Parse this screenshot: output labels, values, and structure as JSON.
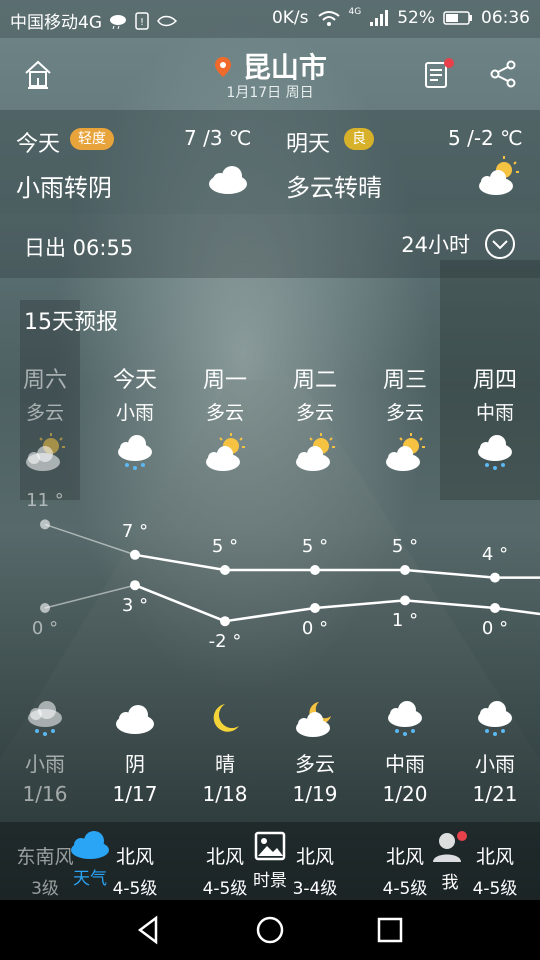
{
  "status_bar": {
    "carrier": "中国移动4G",
    "speed": "0K/s",
    "network": "4G",
    "battery": "52%",
    "time": "06:36"
  },
  "header": {
    "city": "昆山市",
    "date": "1月17日 周日"
  },
  "today": {
    "label": "今天",
    "aqi": "轻度",
    "aqi_color": "#e8a33a",
    "temp": "7 /3 ℃",
    "condition": "小雨转阴",
    "icon": "cloud-icon"
  },
  "tomorrow": {
    "label": "明天",
    "aqi": "良",
    "aqi_color": "#d8b12a",
    "temp": "5 /-2 ℃",
    "condition": "多云转晴",
    "icon": "partly-sunny-icon"
  },
  "sunrise": {
    "text": "日出 06:55",
    "toggle_label": "24小时"
  },
  "forecast": {
    "title": "15天预报",
    "days": [
      {
        "weekday": "周六",
        "day_condition": "多云",
        "high": "11 °",
        "low": "0 °",
        "night_condition": "小雨",
        "date": "1/16",
        "past": true
      },
      {
        "weekday": "今天",
        "day_condition": "小雨",
        "high": "7 °",
        "low": "3 °",
        "night_condition": "阴",
        "date": "1/17",
        "past": false
      },
      {
        "weekday": "周一",
        "day_condition": "多云",
        "high": "5 °",
        "low": "-2 °",
        "night_condition": "晴",
        "date": "1/18",
        "past": false
      },
      {
        "weekday": "周二",
        "day_condition": "多云",
        "high": "5 °",
        "low": "0 °",
        "night_condition": "多云",
        "date": "1/19",
        "past": false
      },
      {
        "weekday": "周三",
        "day_condition": "多云",
        "high": "5 °",
        "low": "1 °",
        "night_condition": "中雨",
        "date": "1/20",
        "past": false
      },
      {
        "weekday": "周四",
        "day_condition": "中雨",
        "high": "4 °",
        "low": "0 °",
        "night_condition": "小雨",
        "date": "1/21",
        "past": false
      }
    ],
    "high_values": [
      11,
      7,
      5,
      5,
      5,
      4
    ],
    "low_values": [
      0,
      3,
      -2,
      0,
      1,
      0
    ]
  },
  "bottom_nav": {
    "winds": [
      {
        "dir": "东南风",
        "level": "3级"
      },
      {
        "dir": "北风",
        "level": "4-5级"
      },
      {
        "dir": "北风",
        "level": "4-5级"
      },
      {
        "dir": "北风",
        "level": "3-4级"
      },
      {
        "dir": "北风",
        "level": "4-5级"
      },
      {
        "dir": "北风",
        "level": "4-5级"
      }
    ],
    "tabs": [
      {
        "label": "天气"
      },
      {
        "label": "时景"
      },
      {
        "label": "我"
      }
    ],
    "active_color": "#2aa4f4"
  }
}
